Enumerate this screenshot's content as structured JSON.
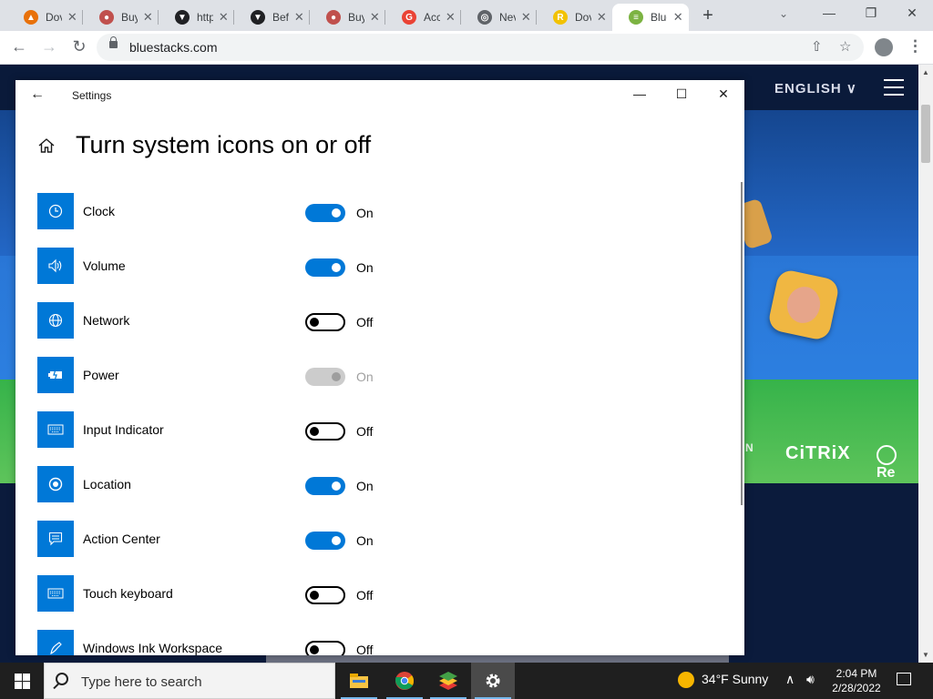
{
  "browser": {
    "tabs": [
      {
        "title": "Dov",
        "favicon_color": "#e8710a",
        "favicon_glyph": "▲",
        "icon": "download-site-icon"
      },
      {
        "title": "Buy",
        "favicon_color": "#c0504d",
        "favicon_glyph": "●",
        "icon": "shop-icon"
      },
      {
        "title": "http",
        "favicon_color": "#202124",
        "favicon_glyph": "▼",
        "icon": "shield-icon"
      },
      {
        "title": "Befc",
        "favicon_color": "#202124",
        "favicon_glyph": "▼",
        "icon": "shield-icon"
      },
      {
        "title": "Buy",
        "favicon_color": "#c0504d",
        "favicon_glyph": "●",
        "icon": "shop-icon"
      },
      {
        "title": "Acc",
        "favicon_color": "#ea4335",
        "favicon_glyph": "G",
        "icon": "google-icon"
      },
      {
        "title": "Nev",
        "favicon_color": "#5f6368",
        "favicon_glyph": "◎",
        "icon": "chrome-icon"
      },
      {
        "title": "Dov",
        "favicon_color": "#f2c200",
        "favicon_glyph": "R",
        "icon": "rockstar-icon"
      },
      {
        "title": "Blue",
        "favicon_color": "#7cb342",
        "favicon_glyph": "≡",
        "icon": "bluestacks-icon",
        "active": true
      }
    ],
    "new_tab_label": "+",
    "url": "bluestacks.com"
  },
  "page": {
    "language": "ENGLISH",
    "partners": [
      "N",
      "CiTRiX",
      "Re"
    ]
  },
  "settings": {
    "window_title": "Settings",
    "heading": "Turn system icons on or off",
    "items": [
      {
        "label": "Clock",
        "state": "on",
        "state_text": "On",
        "icon": "clock-icon"
      },
      {
        "label": "Volume",
        "state": "on",
        "state_text": "On",
        "icon": "volume-icon"
      },
      {
        "label": "Network",
        "state": "off",
        "state_text": "Off",
        "icon": "globe-icon"
      },
      {
        "label": "Power",
        "state": "disabled",
        "state_text": "On",
        "icon": "battery-icon"
      },
      {
        "label": "Input Indicator",
        "state": "off",
        "state_text": "Off",
        "icon": "keyboard-icon"
      },
      {
        "label": "Location",
        "state": "on",
        "state_text": "On",
        "icon": "location-icon"
      },
      {
        "label": "Action Center",
        "state": "on",
        "state_text": "On",
        "icon": "message-icon"
      },
      {
        "label": "Touch keyboard",
        "state": "off",
        "state_text": "Off",
        "icon": "keyboard-icon"
      },
      {
        "label": "Windows Ink Workspace",
        "state": "off",
        "state_text": "Off",
        "icon": "pen-icon"
      }
    ]
  },
  "taskbar": {
    "search_placeholder": "Type here to search",
    "weather": "34°F  Sunny",
    "time": "2:04 PM",
    "date": "2/28/2022",
    "apps": [
      "file-explorer-icon",
      "chrome-icon",
      "bluestacks-icon",
      "settings-gear-icon"
    ]
  },
  "colors": {
    "accent": "#0078d7",
    "toggle_off": "#000000",
    "toggle_disabled": "#cccccc"
  }
}
